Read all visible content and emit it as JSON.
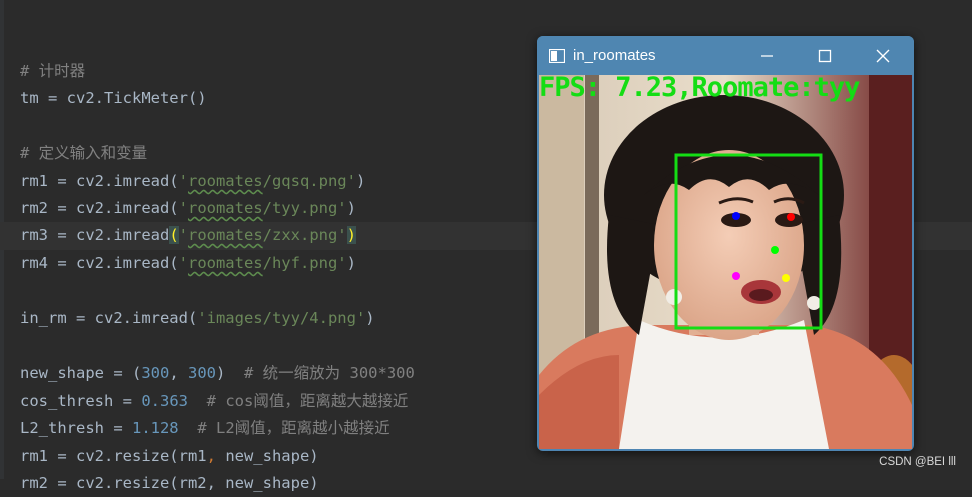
{
  "editor": {
    "lines": [
      {
        "comment": "# 计时器"
      },
      {
        "code": "tm = cv2.TickMeter()"
      },
      {
        "comment": "# 定义输入和变量"
      },
      {
        "prefix": "rm1 = cv2.imread(",
        "str_q1": "'",
        "str_path": "roomates",
        "str_rest": "/gqsq.png'",
        "suffix": ")"
      },
      {
        "prefix": "rm2 = cv2.imread(",
        "str_q1": "'",
        "str_path": "roomates",
        "str_rest": "/tyy.png'",
        "suffix": ")"
      },
      {
        "prefix": "rm3 = cv2.imread",
        "paren_open": "(",
        "str_q1": "'",
        "str_path": "roomates",
        "str_rest": "/zxx.png'",
        "paren_close": ")"
      },
      {
        "prefix": "rm4 = cv2.imread(",
        "str_q1": "'",
        "str_path": "roomates",
        "str_rest": "/hyf.png'",
        "suffix": ")"
      },
      {
        "prefix": "in_rm = cv2.imread(",
        "str": "'images/tyy/4.png'",
        "suffix": ")"
      },
      {
        "prefix": "new_shape = (",
        "n1": "300",
        "mid": ", ",
        "n2": "300",
        "suffix": ")",
        "comment": "  # 统一缩放为 300*300"
      },
      {
        "prefix": "cos_thresh = ",
        "num": "0.363",
        "comment": "  # cos阈值，距离越大越接近"
      },
      {
        "prefix": "L2_thresh = ",
        "num": "1.128",
        "comment": "  # L2阈值，距离越小越接近"
      },
      {
        "prefix": "rm1 = cv2.resize(rm1",
        "mid": ", ",
        "rest": "new_shape)"
      },
      {
        "code": "rm2 = cv2.resize(rm2, new_shape)"
      }
    ]
  },
  "window": {
    "title": "in_roomates",
    "overlay": "FPS: 7.23,Roomate:tyy",
    "title_bar_color": "#4f86b1",
    "detection_color": "#14dd14",
    "landmark_colors": [
      "#0000ff",
      "#ff0000",
      "#00ff00",
      "#ff00ff",
      "#ffff00"
    ]
  },
  "watermark": "CSDN @BEI lll",
  "icons": [
    "app-window-icon",
    "minimize-icon",
    "maximize-icon",
    "close-icon"
  ]
}
